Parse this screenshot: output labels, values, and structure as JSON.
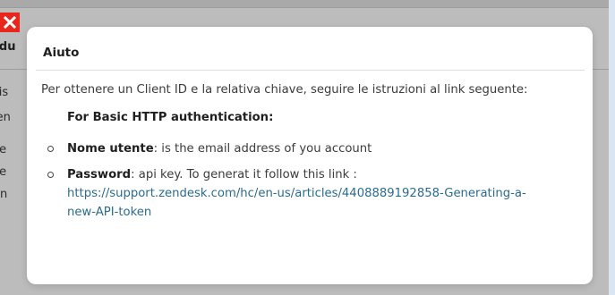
{
  "background": {
    "header_text": "odu",
    "lines": [
      "sis",
      "ien",
      "ke",
      "ke",
      "en"
    ]
  },
  "close_button": {
    "icon": "close-icon",
    "color": "#e8261b"
  },
  "dialog": {
    "title": "Aiuto",
    "intro": "Per ottenere un Client ID e la relativa chiave, seguire le istruzioni al link seguente:",
    "subheading": "For Basic HTTP authentication:",
    "items": [
      {
        "label": "Nome utente",
        "text": ": is the email address of you account"
      },
      {
        "label": "Password",
        "text": ": api key. To generat it follow this link :"
      }
    ],
    "link": "https://support.zendesk.com/hc/en-us/articles/4408889192858-Generating-a-new-API-token",
    "link_color": "#2b6b8f"
  }
}
